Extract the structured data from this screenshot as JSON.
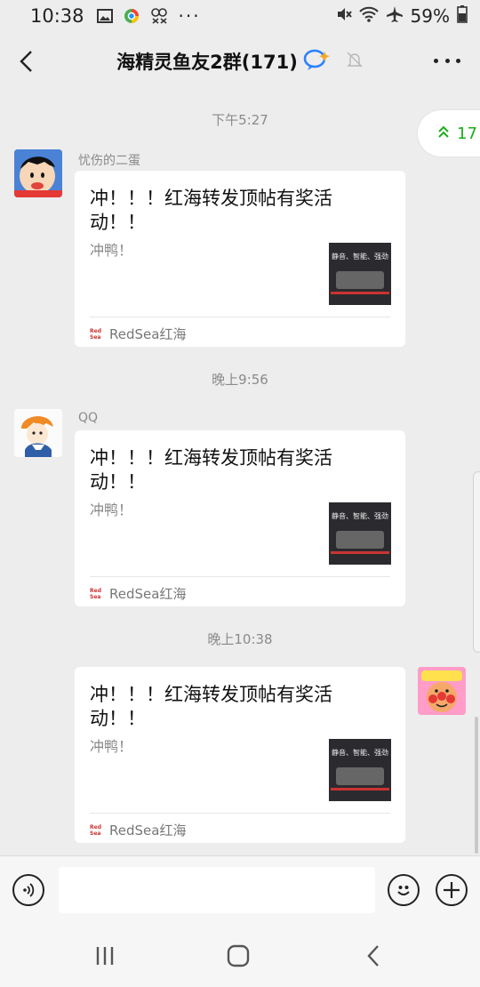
{
  "status_bar": {
    "time": "10:38",
    "battery": "59%"
  },
  "header": {
    "title": "海精灵鱼友2群(171)"
  },
  "pill": {
    "count": "17"
  },
  "messages": [
    {
      "timestamp": "下午5:27",
      "sender": "忧伤的二蛋",
      "title": "冲！！！红海转发顶帖有奖活动！！",
      "desc": "冲鸭！",
      "thumb_text": "静音、智能、强劲",
      "source": "RedSea红海"
    },
    {
      "timestamp": "晚上9:56",
      "sender": "QQ",
      "title": "冲！！！红海转发顶帖有奖活动！！",
      "desc": "冲鸭！",
      "thumb_text": "静音、智能、强劲",
      "source": "RedSea红海"
    },
    {
      "timestamp": "晚上10:38",
      "sender": "",
      "title": "冲！！！红海转发顶帖有奖活动！！",
      "desc": "冲鸭！",
      "thumb_text": "静音、智能、强劲",
      "source": "RedSea红海"
    }
  ],
  "input": {
    "value": ""
  },
  "icons": {
    "back": "back-arrow-icon",
    "more": "more-dots-icon",
    "voice": "voice-icon",
    "emoji": "emoji-icon",
    "add": "add-icon"
  }
}
